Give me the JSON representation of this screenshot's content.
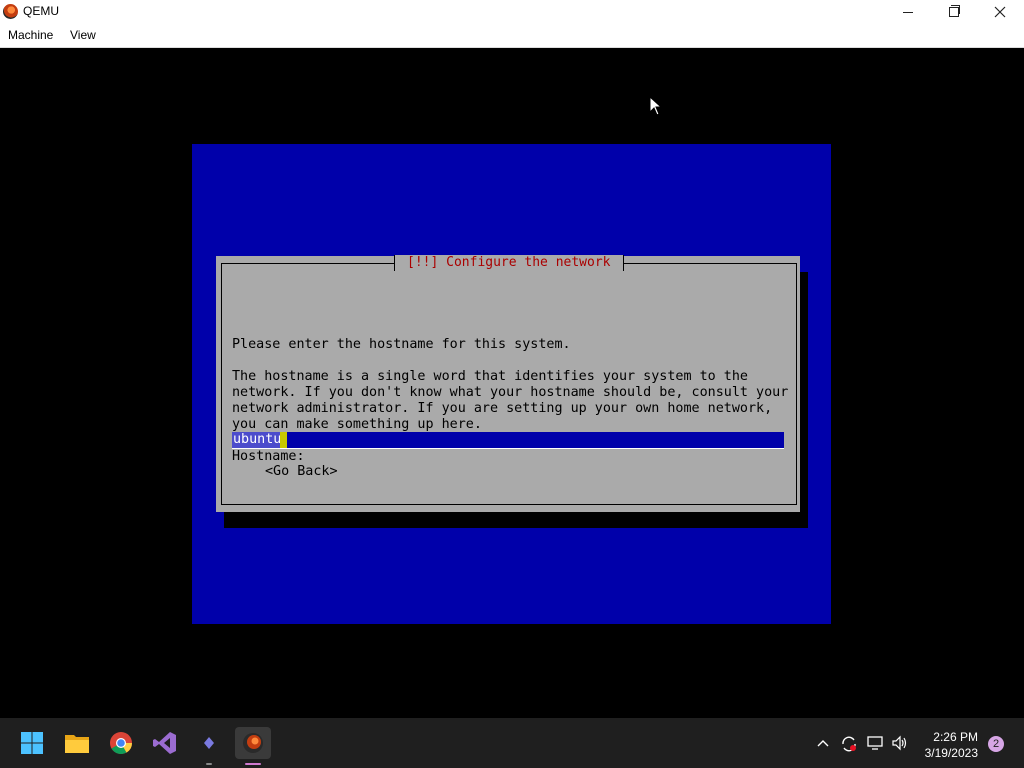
{
  "window": {
    "title": "QEMU",
    "controls": [
      "minimize-icon",
      "maximize-icon",
      "close-icon"
    ]
  },
  "menu": {
    "items": [
      "Machine",
      "View"
    ]
  },
  "installer": {
    "dialog_title": "[!!] Configure the network",
    "prompt": "Please enter the hostname for this system.",
    "description": "The hostname is a single word that identifies your system to the\nnetwork. If you don't know what your hostname should be, consult your\nnetwork administrator. If you are setting up your own home network,\nyou can make something up here.",
    "field_label": "Hostname:",
    "hostname_value": "ubuntu",
    "go_back": "<Go Back>",
    "colors": {
      "background": "#0000aa",
      "dialog": "#aaaaaa",
      "title": "#aa0000"
    }
  },
  "taskbar": {
    "apps": [
      "start-icon",
      "file-explorer-icon",
      "chrome-icon",
      "visual-studio-icon",
      "app-icon",
      "qemu-icon"
    ],
    "tray": [
      "chevron-up-icon",
      "sync-icon",
      "network-icon",
      "volume-icon"
    ],
    "time": "2:26 PM",
    "date": "3/19/2023",
    "notification_count": "2"
  }
}
